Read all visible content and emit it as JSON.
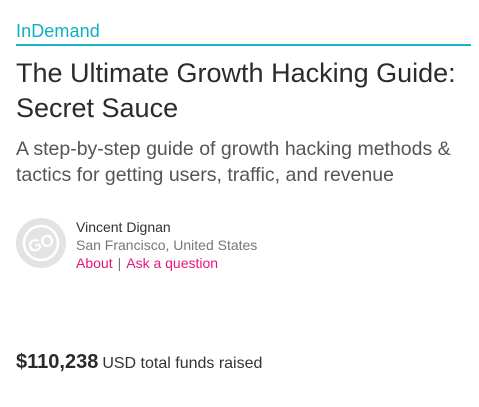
{
  "brand": {
    "name": "InDemand",
    "accent_color": "#0fb0c2"
  },
  "campaign": {
    "title": "The Ultimate Growth Hacking Guide: Secret Sauce",
    "tagline": "A step-by-step guide of growth hacking methods & tactics for getting users, traffic, and revenue"
  },
  "owner": {
    "avatar_icon": "avatar-placeholder-icon",
    "avatar_initials": "GO",
    "name": "Vincent Dignan",
    "location": "San Francisco, United States",
    "links": {
      "about": "About",
      "separator": "|",
      "ask": "Ask a question"
    },
    "link_color": "#e5157a"
  },
  "funding": {
    "amount": "$110,238",
    "label": "USD total funds raised"
  }
}
